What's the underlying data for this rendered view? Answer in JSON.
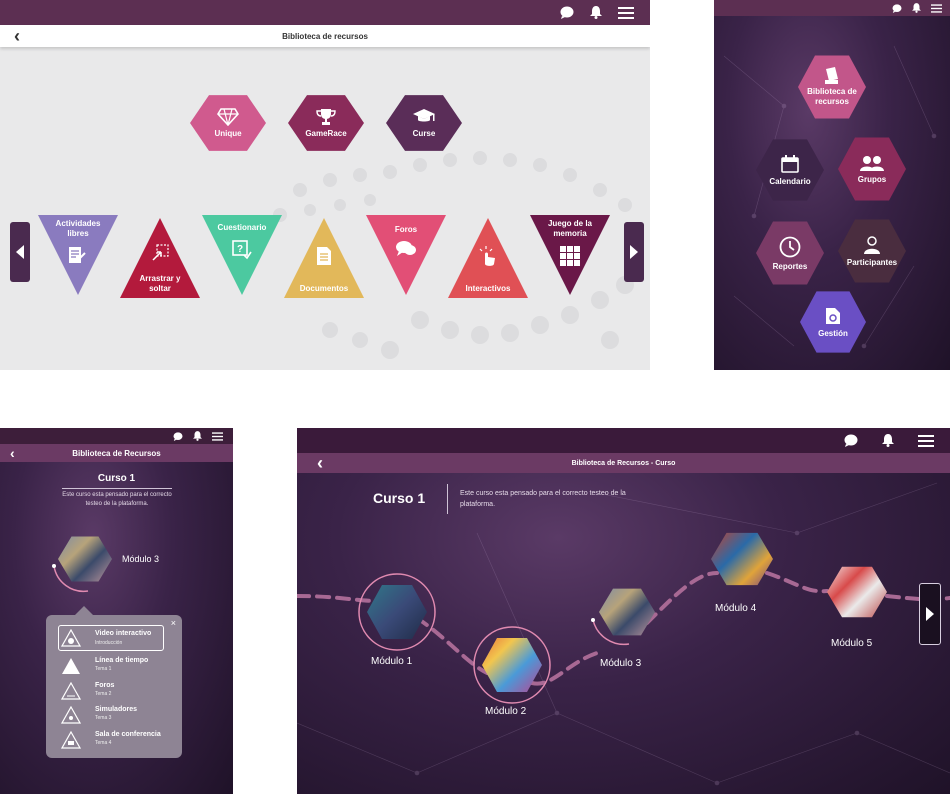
{
  "colors": {
    "topbar": "#5c2f52",
    "pink": "#d05a8e",
    "magenta_dark": "#8a2b5a",
    "plum": "#5a2d58",
    "lavender": "#8a7bbf",
    "crimson": "#b31a3c",
    "mint": "#4cc9a0",
    "mustard": "#e2b85a",
    "rose": "#e24f76",
    "coral": "#e05055",
    "wine": "#6a1848"
  },
  "panel1": {
    "title": "Biblioteca de recursos",
    "top_tiles": [
      {
        "label": "Unique",
        "icon": "diamond-icon"
      },
      {
        "label": "GameRace",
        "icon": "trophy-icon"
      },
      {
        "label": "Curse",
        "icon": "graduation-cap-icon"
      }
    ],
    "bottom_tiles": [
      {
        "label": "Actividades libres",
        "icon": "edit-document-icon"
      },
      {
        "label": "Arrastrar y soltar",
        "icon": "drag-drop-icon"
      },
      {
        "label": "Cuestionario",
        "icon": "quiz-icon"
      },
      {
        "label": "Documentos",
        "icon": "document-icon"
      },
      {
        "label": "Foros",
        "icon": "chat-bubbles-icon"
      },
      {
        "label": "Interactivos",
        "icon": "touch-icon"
      },
      {
        "label": "Juego de la memoria",
        "icon": "grid-icon"
      }
    ]
  },
  "panel2": {
    "items": [
      {
        "label": "Biblioteca de recursos",
        "icon": "books-icon"
      },
      {
        "label": "Calendario",
        "icon": "calendar-icon"
      },
      {
        "label": "Grupos",
        "icon": "group-icon"
      },
      {
        "label": "Reportes",
        "icon": "clock-icon"
      },
      {
        "label": "Participantes",
        "icon": "participant-icon"
      },
      {
        "label": "Gestión",
        "icon": "settings-document-icon"
      }
    ]
  },
  "panel3": {
    "title": "Biblioteca de Recursos",
    "course_title": "Curso 1",
    "course_desc": "Este curso esta pensado para el correcto testeo de la plataforma.",
    "module_label": "Módulo 3",
    "menu_items": [
      {
        "title": "Video interactivo",
        "subtitle": "Introducción"
      },
      {
        "title": "Línea de tiempo",
        "subtitle": "Tema 1"
      },
      {
        "title": "Foros",
        "subtitle": "Tema 2"
      },
      {
        "title": "Simuladores",
        "subtitle": "Tema 3"
      },
      {
        "title": "Sala de conferencia",
        "subtitle": "Tema 4"
      }
    ]
  },
  "panel4": {
    "title": "Biblioteca de Recursos - Curso",
    "course_title": "Curso 1",
    "course_desc": "Este curso esta pensado para el correcto testeo de la plataforma.",
    "modules": [
      "Módulo 1",
      "Módulo 2",
      "Módulo 3",
      "Módulo 4",
      "Módulo 5"
    ]
  }
}
